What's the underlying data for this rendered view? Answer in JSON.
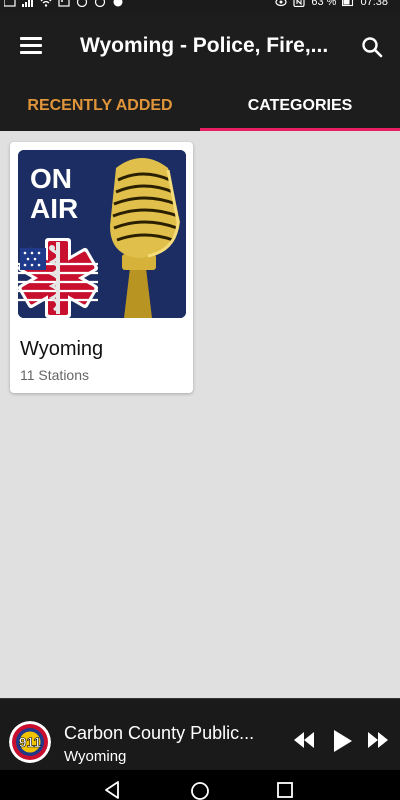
{
  "status_bar": {
    "battery_percent": "63 %",
    "time": "07:38"
  },
  "app_bar": {
    "title": "Wyoming - Police, Fire,...",
    "menu_icon": "hamburger-menu-icon",
    "search_icon": "search-icon"
  },
  "tabs": [
    {
      "label": "RECENTLY ADDED",
      "selected": false
    },
    {
      "label": "CATEGORIES",
      "selected": true
    }
  ],
  "colors": {
    "accent": "#e91e63",
    "tab_inactive": "#e0953a",
    "app_bar": "#1d1d1d",
    "background": "#e0e0e0"
  },
  "categories": [
    {
      "title": "Wyoming",
      "subtitle": "11 Stations",
      "image_text": [
        "ON",
        "AIR"
      ]
    }
  ],
  "player": {
    "title": "Carbon County Public...",
    "subtitle": "Wyoming",
    "logo_text": "911"
  }
}
